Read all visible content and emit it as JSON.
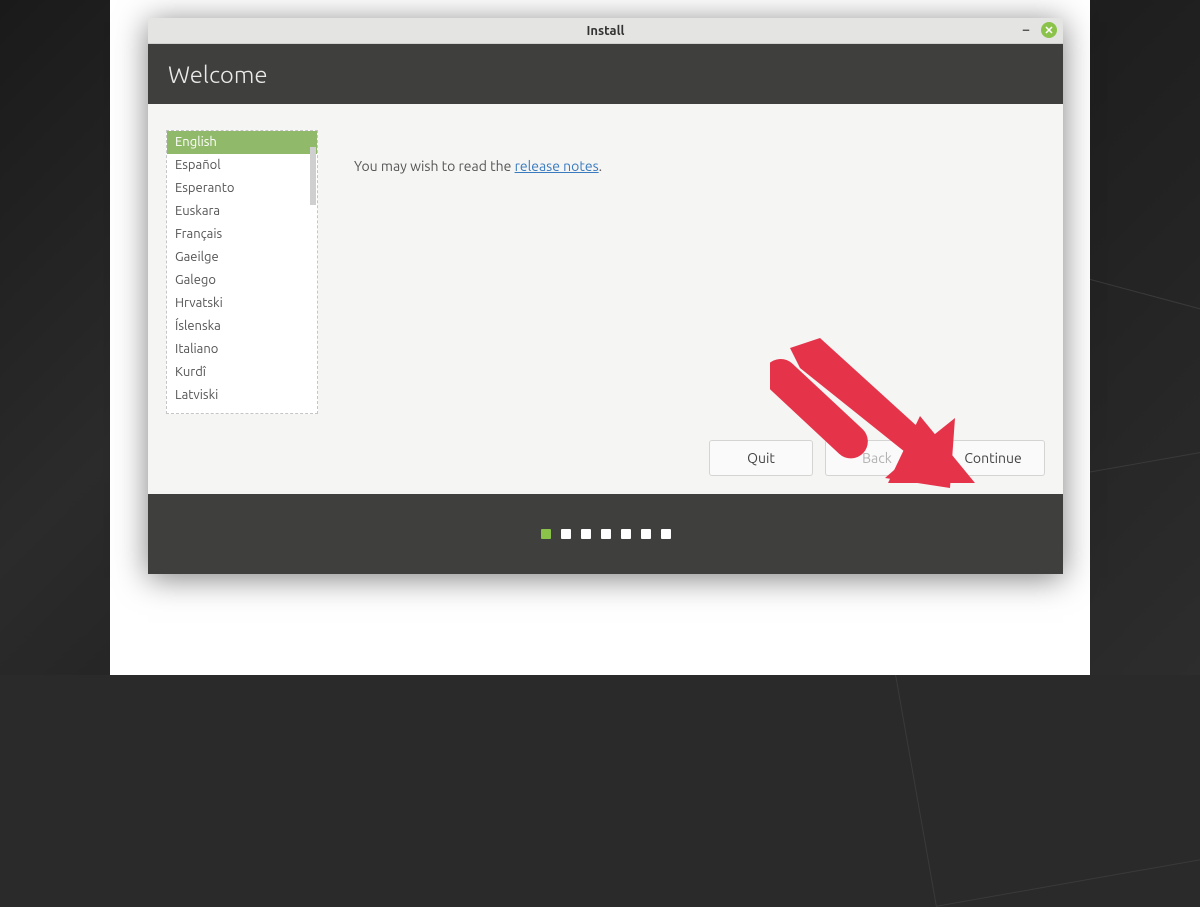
{
  "window": {
    "title": "Install"
  },
  "header": {
    "title": "Welcome"
  },
  "languages": {
    "items": [
      "English",
      "Español",
      "Esperanto",
      "Euskara",
      "Français",
      "Gaeilge",
      "Galego",
      "Hrvatski",
      "Íslenska",
      "Italiano",
      "Kurdî",
      "Latviski"
    ],
    "selected_index": 0
  },
  "release_notes": {
    "prefix": "You may wish to read the ",
    "link_text": "release notes",
    "suffix": "."
  },
  "buttons": {
    "quit": "Quit",
    "back": "Back",
    "continue": "Continue"
  },
  "progress": {
    "total_steps": 7,
    "current_step": 1
  },
  "colors": {
    "accent": "#8bc34a",
    "header_bg": "#3f3f3d",
    "link": "#3a7bbf",
    "arrow": "#e5344a"
  }
}
